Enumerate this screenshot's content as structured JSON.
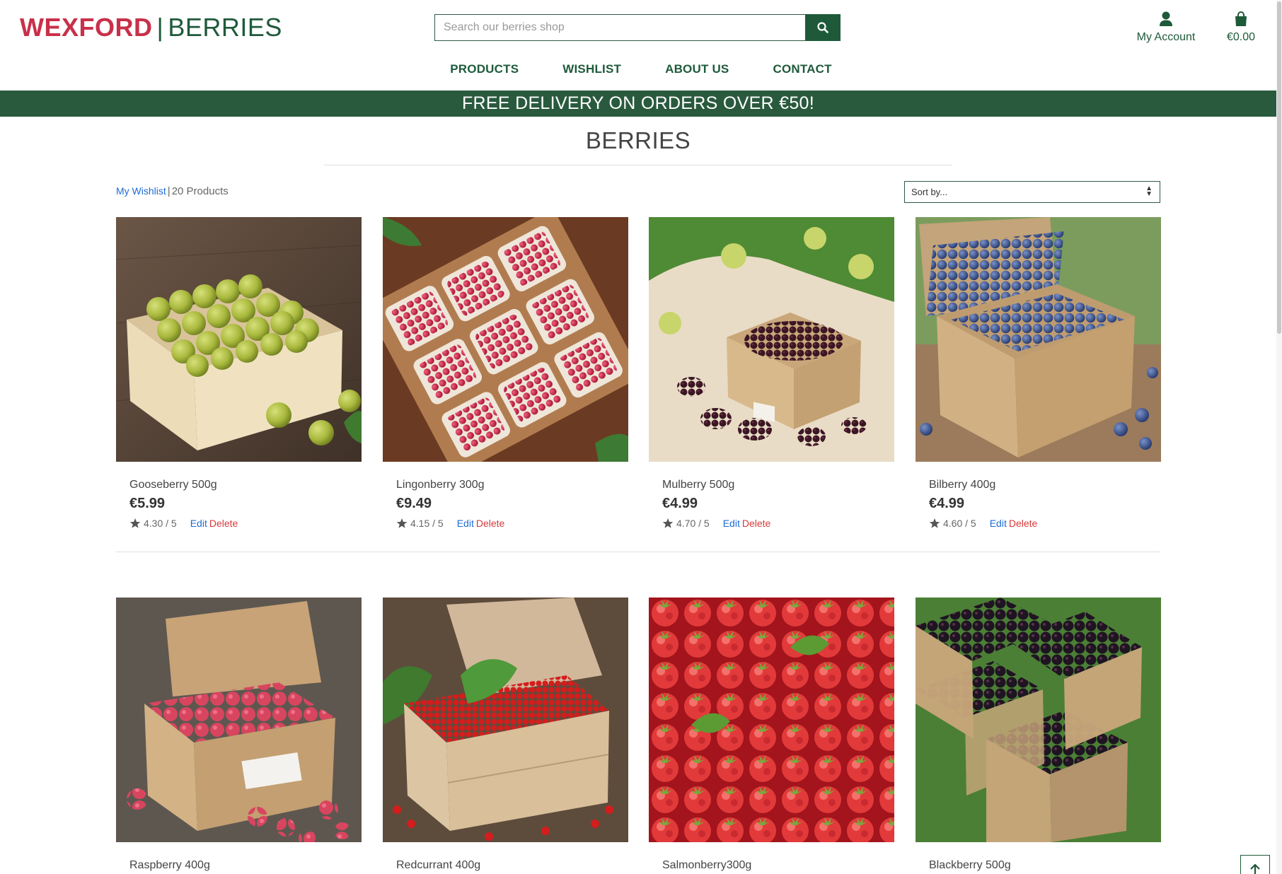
{
  "header": {
    "brand_primary": "WEXFORD",
    "brand_separator": "|",
    "brand_secondary": "BERRIES",
    "search_placeholder": "Search our berries shop",
    "account_label": "My Account",
    "cart_total": "€0.00"
  },
  "nav": {
    "items": [
      {
        "label": "PRODUCTS"
      },
      {
        "label": "WISHLIST"
      },
      {
        "label": "ABOUT US"
      },
      {
        "label": "CONTACT"
      }
    ]
  },
  "banner": {
    "text": "FREE DELIVERY ON ORDERS OVER €50!"
  },
  "page": {
    "title": "BERRIES",
    "wishlist_link": "My Wishlist",
    "separator": "|",
    "product_count": "20 Products",
    "sort_selected": "Sort by..."
  },
  "products": [
    {
      "name": "Gooseberry 500g",
      "price": "€5.99",
      "rating": "4.30 / 5",
      "edit": "Edit",
      "delete": "Delete"
    },
    {
      "name": "Lingonberry 300g",
      "price": "€9.49",
      "rating": "4.15 / 5",
      "edit": "Edit",
      "delete": "Delete"
    },
    {
      "name": "Mulberry 500g",
      "price": "€4.99",
      "rating": "4.70 / 5",
      "edit": "Edit",
      "delete": "Delete"
    },
    {
      "name": "Bilberry 400g",
      "price": "€4.99",
      "rating": "4.60 / 5",
      "edit": "Edit",
      "delete": "Delete"
    },
    {
      "name": "Raspberry 400g"
    },
    {
      "name": "Redcurrant 400g"
    },
    {
      "name": "Salmonberry300g"
    },
    {
      "name": "Blackberry 500g"
    }
  ],
  "colors": {
    "brand_red": "#c8304a",
    "brand_green": "#1e5a3a",
    "banner_green": "#2a5a3e",
    "link_blue": "#1d6bd6",
    "delete_red": "#d63a3a"
  },
  "icons": {
    "search": "search-icon",
    "account": "user-icon",
    "cart": "shopping-bag-icon",
    "rating": "star-icon",
    "sort": "sort-arrows-icon",
    "back_to_top": "arrow-up-icon"
  }
}
